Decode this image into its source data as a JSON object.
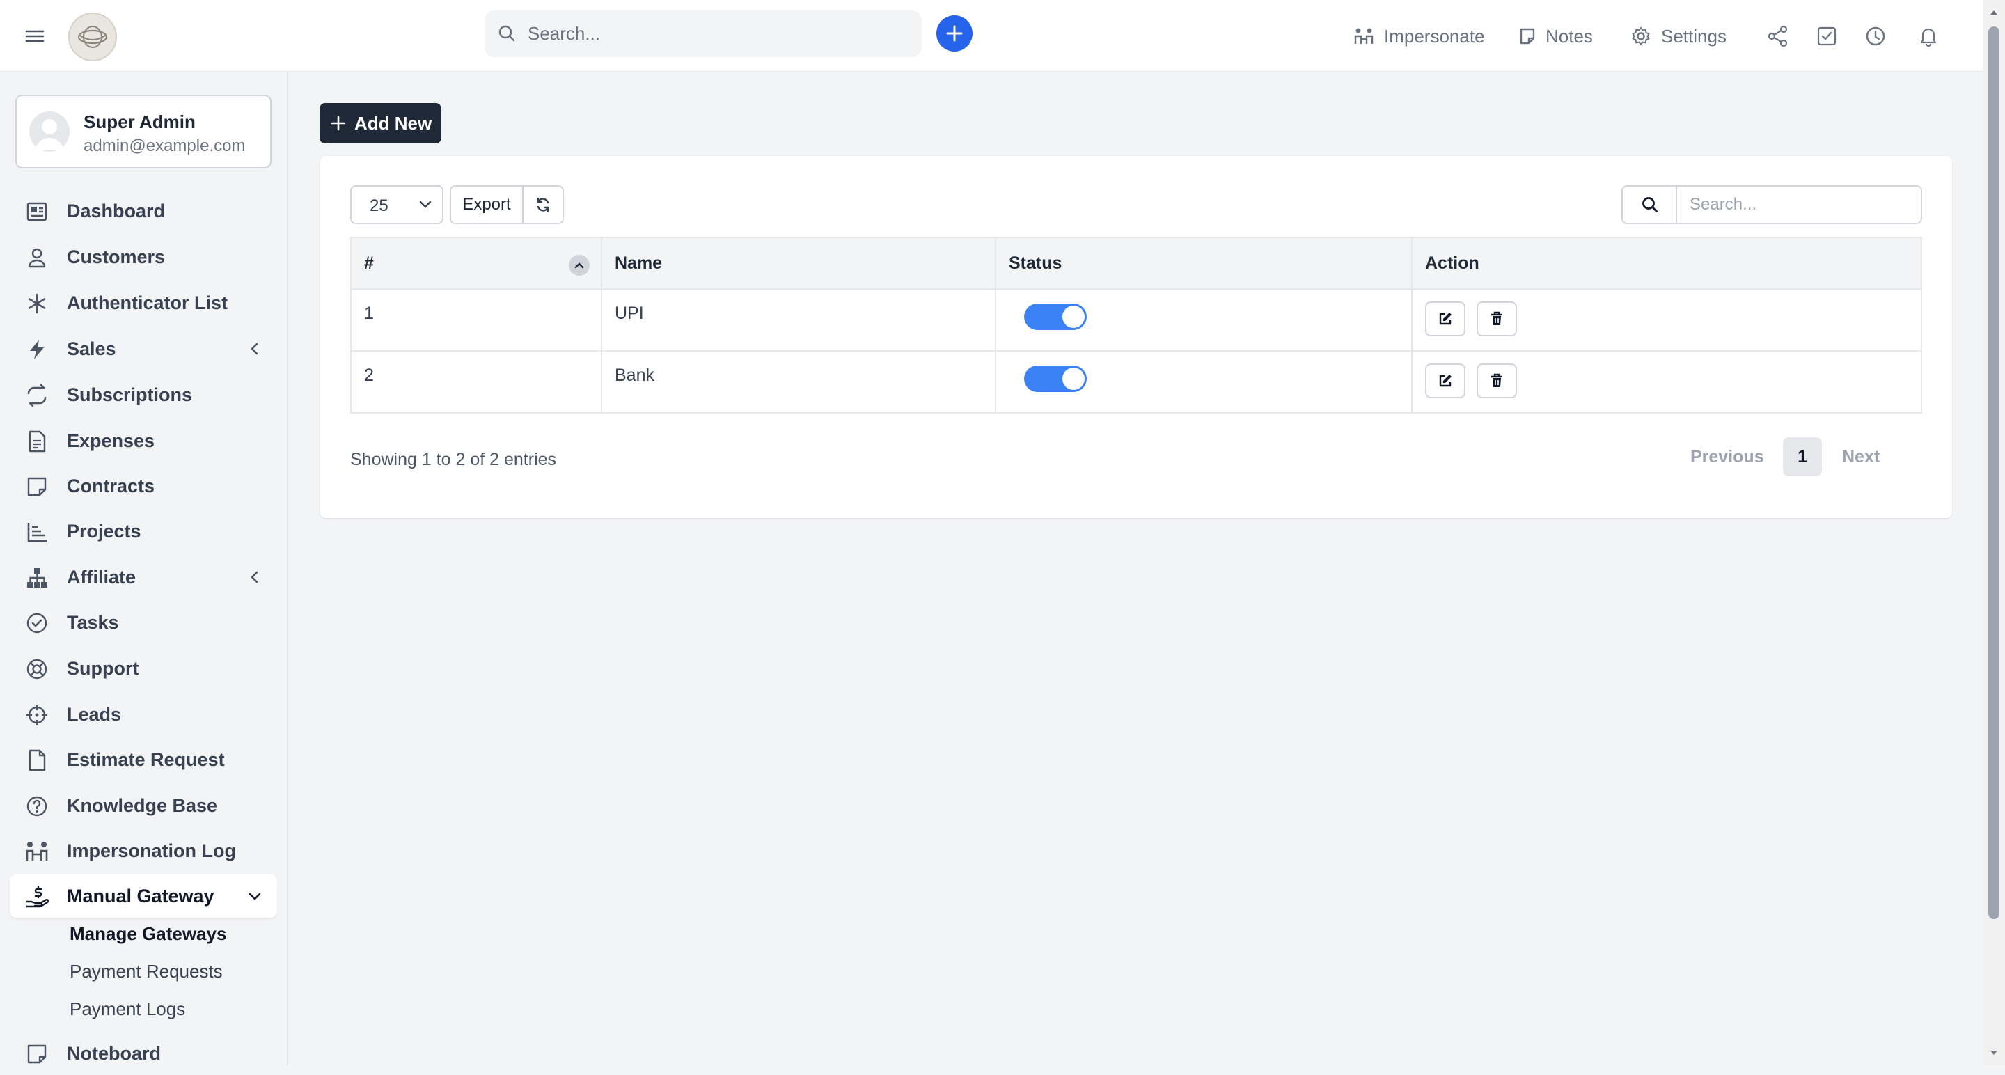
{
  "header": {
    "search_placeholder": "Search...",
    "impersonate_label": "Impersonate",
    "notes_label": "Notes",
    "settings_label": "Settings"
  },
  "user": {
    "name": "Super Admin",
    "email": "admin@example.com"
  },
  "sidebar": {
    "items": [
      {
        "label": "Dashboard",
        "icon": "dashboard-icon"
      },
      {
        "label": "Customers",
        "icon": "user-icon"
      },
      {
        "label": "Authenticator List",
        "icon": "asterisk-icon"
      },
      {
        "label": "Sales",
        "icon": "bolt-icon",
        "expandable": true
      },
      {
        "label": "Subscriptions",
        "icon": "repeat-icon"
      },
      {
        "label": "Expenses",
        "icon": "document-icon"
      },
      {
        "label": "Contracts",
        "icon": "note-icon"
      },
      {
        "label": "Projects",
        "icon": "chart-icon"
      },
      {
        "label": "Affiliate",
        "icon": "sitemap-icon",
        "expandable": true
      },
      {
        "label": "Tasks",
        "icon": "check-circle-icon"
      },
      {
        "label": "Support",
        "icon": "lifebuoy-icon"
      },
      {
        "label": "Leads",
        "icon": "crosshair-icon"
      },
      {
        "label": "Estimate Request",
        "icon": "file-icon"
      },
      {
        "label": "Knowledge Base",
        "icon": "question-icon"
      },
      {
        "label": "Impersonation Log",
        "icon": "people-icon"
      },
      {
        "label": "Manual Gateway",
        "icon": "hand-dollar-icon",
        "active": true
      },
      {
        "label": "Noteboard",
        "icon": "note-icon"
      }
    ],
    "subitems": [
      {
        "label": "Manage Gateways",
        "active": true
      },
      {
        "label": "Payment Requests"
      },
      {
        "label": "Payment Logs"
      }
    ]
  },
  "main": {
    "add_new_label": "Add New",
    "per_page": "25",
    "export_label": "Export",
    "search_placeholder": "Search...",
    "table": {
      "columns": [
        "#",
        "Name",
        "Status",
        "Action"
      ],
      "rows": [
        {
          "id": "1",
          "name": "UPI",
          "status": true
        },
        {
          "id": "2",
          "name": "Bank",
          "status": true
        }
      ]
    },
    "info": "Showing 1 to 2 of 2 entries",
    "pagination": {
      "previous": "Previous",
      "current": "1",
      "next": "Next"
    }
  },
  "colors": {
    "primary": "#2563eb",
    "toggle_on": "#3b82f6",
    "dark_button": "#1f2937",
    "background": "#f3f4f6"
  }
}
